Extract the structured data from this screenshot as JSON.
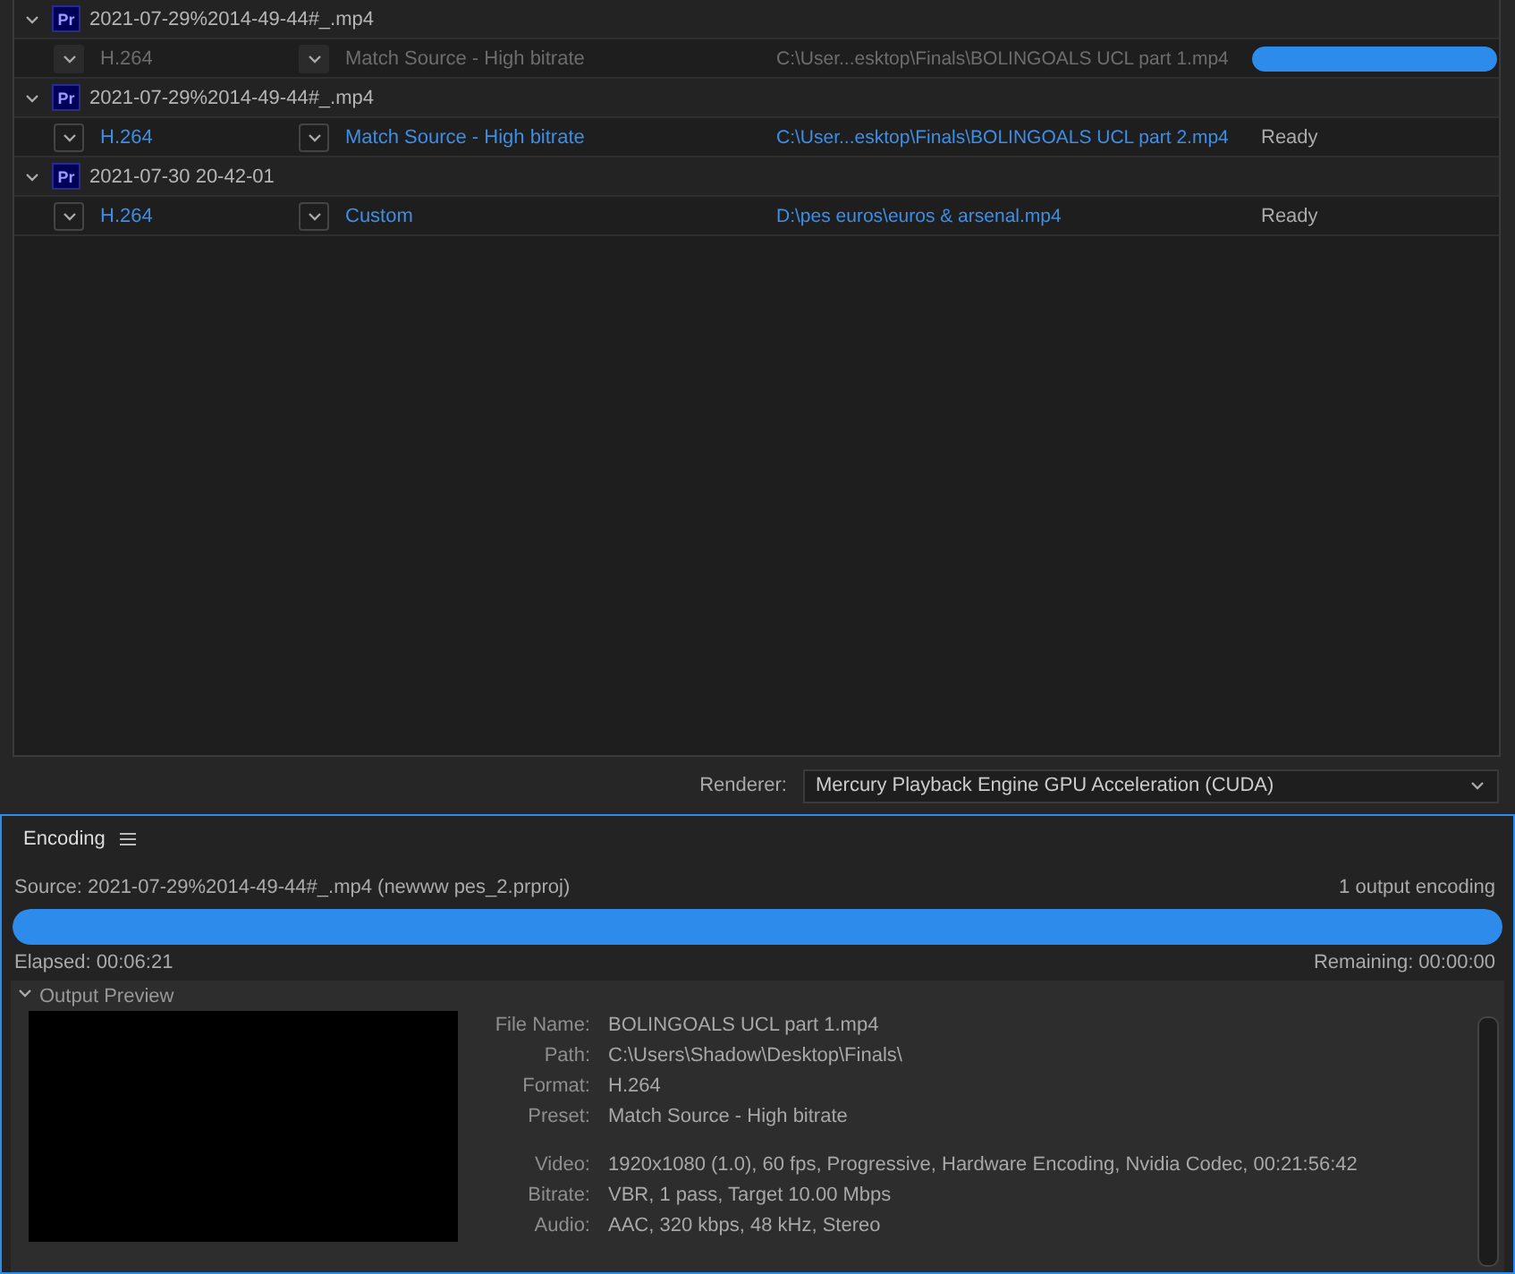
{
  "queue": [
    {
      "badge": "Pr",
      "source": "2021-07-29%2014-49-44#_.mp4",
      "expanded": true,
      "outputs": [
        {
          "format": "H.264",
          "preset": "Match Source - High bitrate",
          "output": "C:\\User...esktop\\Finals\\BOLINGOALS UCL part 1.mp4",
          "disabled": true,
          "kind": "progress",
          "level": 1
        }
      ]
    },
    {
      "badge": "Pr",
      "source": "2021-07-29%2014-49-44#_.mp4",
      "expanded": true,
      "outputs": [
        {
          "format": "H.264",
          "preset": "Match Source - High bitrate",
          "output": "C:\\User...esktop\\Finals\\BOLINGOALS UCL part 2.mp4",
          "disabled": false,
          "kind": "status",
          "status": "Ready"
        }
      ]
    },
    {
      "badge": "Pr",
      "source": "2021-07-30 20-42-01",
      "expanded": true,
      "outputs": [
        {
          "format": "H.264",
          "preset": "Custom",
          "output": "D:\\pes euros\\euros & arsenal.mp4",
          "disabled": false,
          "kind": "status",
          "status": "Ready"
        }
      ]
    }
  ],
  "renderer": {
    "label": "Renderer:",
    "value": "Mercury Playback Engine GPU Acceleration (CUDA)"
  },
  "encoding": {
    "title": "Encoding",
    "source": "Source: 2021-07-29%2014-49-44#_.mp4 (newww pes_2.prproj)",
    "count": "1 output encoding",
    "level": 1,
    "elapsed": "Elapsed: 00:06:21",
    "remaining": "Remaining: 00:00:00",
    "preview": {
      "title": "Output Preview",
      "expanded": true,
      "detail_groups": [
        [
          {
            "label": "File Name:",
            "value": "BOLINGOALS UCL part 1.mp4"
          },
          {
            "label": "Path:",
            "value": "C:\\Users\\Shadow\\Desktop\\Finals\\"
          },
          {
            "label": "Format:",
            "value": "H.264"
          },
          {
            "label": "Preset:",
            "value": "Match Source - High bitrate"
          }
        ],
        [
          {
            "label": "Video:",
            "value": "1920x1080 (1.0), 60 fps, Progressive, Hardware Encoding, Nvidia Codec, 00:21:56:42"
          },
          {
            "label": "Bitrate:",
            "value": "VBR, 1 pass, Target 10.00 Mbps"
          },
          {
            "label": "Audio:",
            "value": "AAC, 320 kbps, 48 kHz, Stereo"
          }
        ]
      ]
    }
  }
}
